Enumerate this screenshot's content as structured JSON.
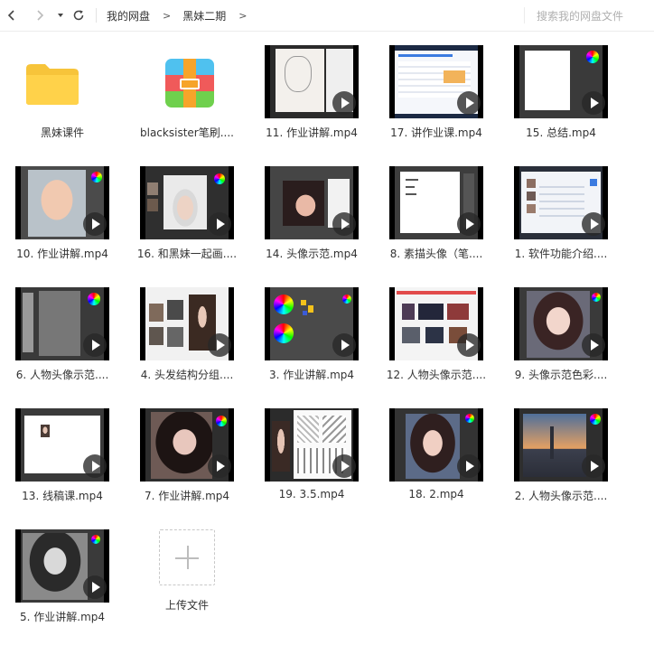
{
  "toolbar": {
    "back_icon": "chevron-left-icon",
    "forward_icon": "chevron-right-icon",
    "history_icon": "caret-down-icon",
    "refresh_icon": "refresh-icon",
    "breadcrumbs": [
      "我的网盘",
      "黑妹二期"
    ],
    "search_placeholder": "搜索我的网盘文件"
  },
  "items": [
    {
      "type": "folder",
      "label": "黑妹课件"
    },
    {
      "type": "archive",
      "label": "blacksister笔刷...."
    },
    {
      "type": "video",
      "label": "11. 作业讲解.mp4",
      "thumb": "sketch"
    },
    {
      "type": "video",
      "label": "17. 讲作业课.mp4",
      "thumb": "web-blue"
    },
    {
      "type": "video",
      "label": "15. 总结.mp4",
      "thumb": "canvas-white"
    },
    {
      "type": "video",
      "label": "10. 作业讲解.mp4",
      "thumb": "portrait-boy"
    },
    {
      "type": "video",
      "label": "16. 和黑妹一起画....",
      "thumb": "portrait-hat"
    },
    {
      "type": "video",
      "label": "14. 头像示范.mp4",
      "thumb": "portrait-smile"
    },
    {
      "type": "video",
      "label": "8. 素描头像（笔....",
      "thumb": "doc-text"
    },
    {
      "type": "video",
      "label": "1. 软件功能介绍....",
      "thumb": "app-list"
    },
    {
      "type": "video",
      "label": "6. 人物头像示范....",
      "thumb": "gray-canvas"
    },
    {
      "type": "video",
      "label": "4. 头发结构分组....",
      "thumb": "ref-heads"
    },
    {
      "type": "video",
      "label": "3. 作业讲解.mp4",
      "thumb": "color-wheels"
    },
    {
      "type": "video",
      "label": "12. 人物头像示范....",
      "thumb": "web-gallery"
    },
    {
      "type": "video",
      "label": "9. 头像示范色彩....",
      "thumb": "portrait-anime"
    },
    {
      "type": "video",
      "label": "13. 线稿课.mp4",
      "thumb": "white-small"
    },
    {
      "type": "video",
      "label": "7. 作业讲解.mp4",
      "thumb": "portrait-dark"
    },
    {
      "type": "video",
      "label": "19. 3.5.mp4",
      "thumb": "manga-page"
    },
    {
      "type": "video",
      "label": "18. 2.mp4",
      "thumb": "portrait-girl"
    },
    {
      "type": "video",
      "label": "2. 人物头像示范....",
      "thumb": "city-sunset"
    },
    {
      "type": "video",
      "label": "5. 作业讲解.mp4",
      "thumb": "portrait-gray"
    },
    {
      "type": "upload",
      "label": "上传文件"
    }
  ]
}
